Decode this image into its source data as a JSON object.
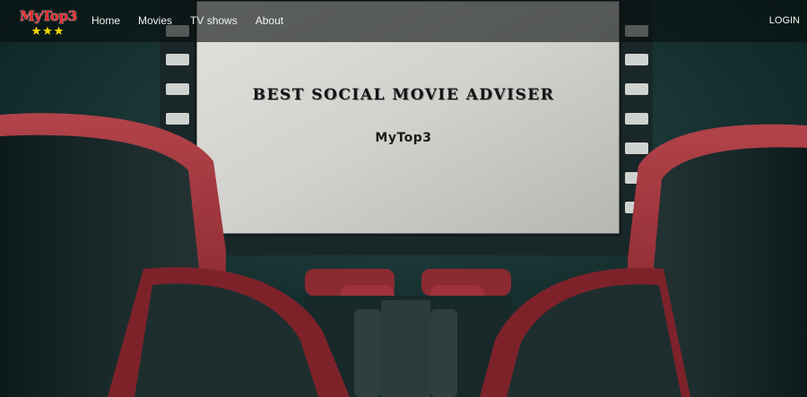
{
  "brand": {
    "name": "MyTop3",
    "stars": "★★★",
    "colors": {
      "text": "#e8262a",
      "stars": "#f5d400"
    }
  },
  "nav": {
    "items": [
      {
        "label": "Home"
      },
      {
        "label": "Movies"
      },
      {
        "label": "TV shows"
      },
      {
        "label": "About"
      }
    ],
    "login_label": "LOGIN"
  },
  "hero": {
    "title": "BEST SOCIAL MOVIE ADVISER",
    "subtitle": "MyTop3",
    "image": "cinema-theater-seats-screen"
  }
}
